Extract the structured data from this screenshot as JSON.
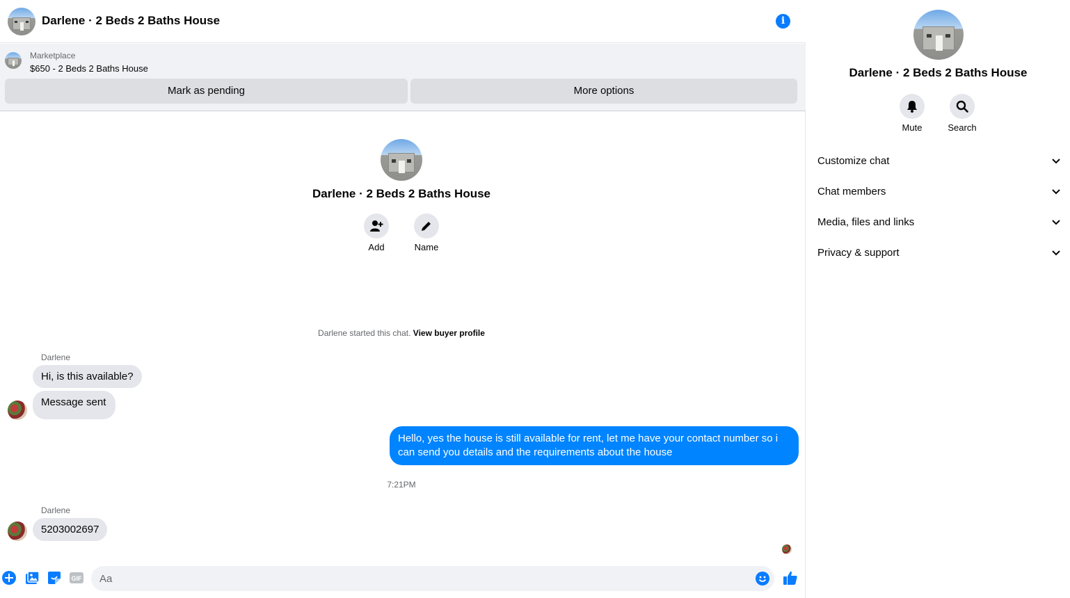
{
  "header": {
    "title": "Darlene · 2 Beds 2 Baths House",
    "info_icon": "info-icon"
  },
  "listing": {
    "source": "Marketplace",
    "title": "$650 - 2 Beds 2 Baths House",
    "pending_button": "Mark as pending",
    "more_button": "More options"
  },
  "intro": {
    "title": "Darlene · 2 Beds 2 Baths House",
    "add_label": "Add",
    "name_label": "Name"
  },
  "thread": {
    "started_text": "Darlene started this chat.",
    "view_profile_link": "View buyer profile",
    "group1": {
      "sender": "Darlene",
      "messages": [
        "Hi, is this available?",
        "Message sent"
      ]
    },
    "outgoing": "Hello, yes the house is still available for rent, let me have your contact number so i can send you details and the requirements about the house",
    "timestamp": "7:21PM",
    "group2": {
      "sender": "Darlene",
      "messages": [
        "5203002697"
      ]
    }
  },
  "composer": {
    "placeholder": "Aa",
    "accent_color": "#0a7cff"
  },
  "side": {
    "title": "Darlene · 2 Beds 2 Baths House",
    "mute_label": "Mute",
    "search_label": "Search",
    "sections": [
      "Customize chat",
      "Chat members",
      "Media, files and links",
      "Privacy & support"
    ]
  },
  "colors": {
    "outgoing_bubble": "#0084ff",
    "incoming_bubble": "#e4e6eb",
    "accent": "#0a7cff"
  }
}
